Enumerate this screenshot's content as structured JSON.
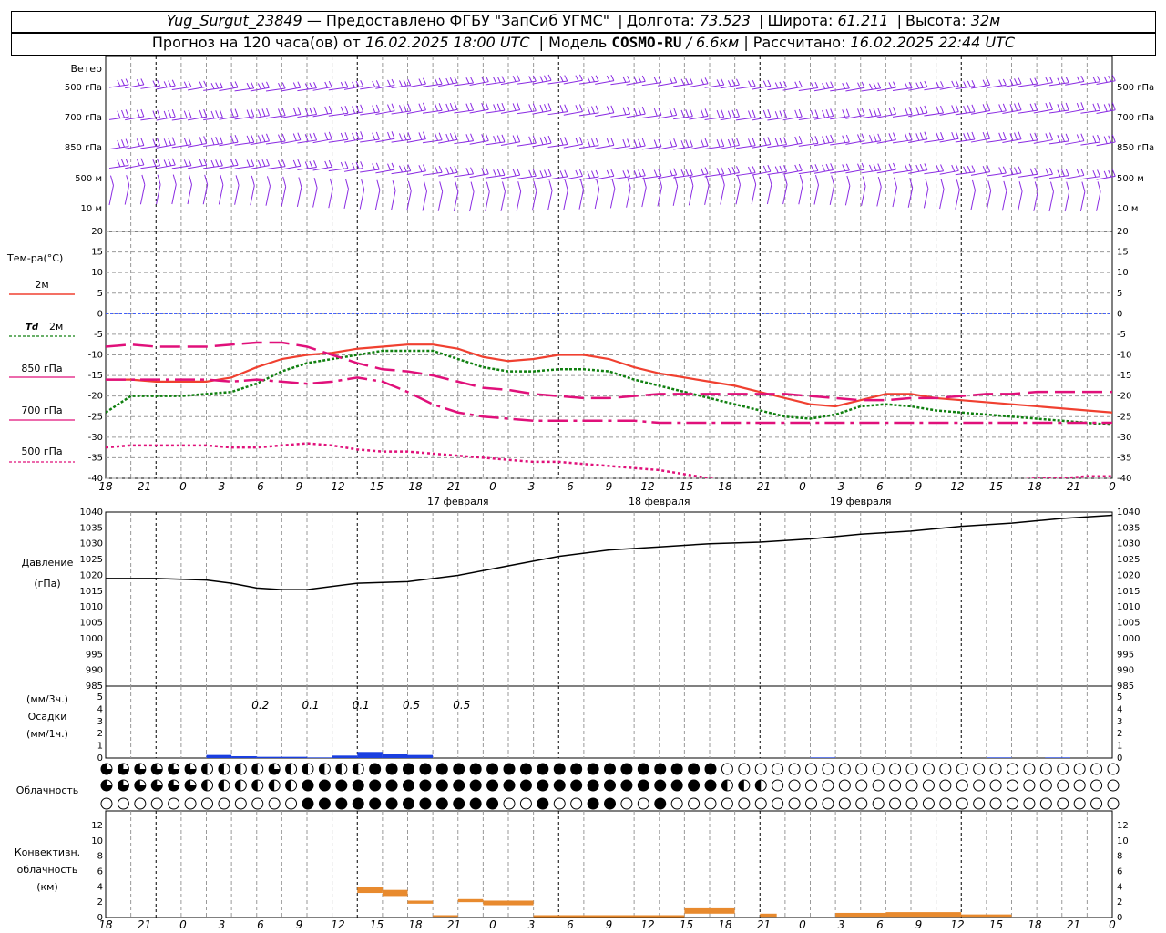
{
  "header": {
    "station": "Yug_Surgut_23849",
    "provider": "— Предоставлено ФГБУ \"ЗапСиб УГМС\"",
    "lon_label": "Долгота:",
    "lon": "73.523",
    "lat_label": "Широта:",
    "lat": "61.211",
    "alt_label": "Высота:",
    "alt": "32м",
    "forecast_label": "Прогноз на 120 часа(ов) от",
    "forecast_start": "16.02.2025 18:00 UTC",
    "model_label": "| Модель",
    "model": "COSMO-RU",
    "resolution": "/ 6.6км",
    "computed_label": "| Рассчитано:",
    "computed": "16.02.2025 22:44 UTC"
  },
  "colors": {
    "wind": "#8a2be2",
    "t2m": "#f04030",
    "td2m": "#108010",
    "t850": "#e0107a",
    "t700": "#e0107a",
    "t500": "#e0107a",
    "zero_line": "#3050ff",
    "pressure": "#000000",
    "precip": "#1a3fe0",
    "conv": "#e88a2e",
    "grid": "#9a9a9a"
  },
  "x_axis": {
    "ticks": [
      "18",
      "21",
      "0",
      "3",
      "6",
      "9",
      "12",
      "15",
      "18",
      "21",
      "0",
      "3",
      "6",
      "9",
      "12",
      "15",
      "18",
      "21",
      "0",
      "3",
      "6",
      "9",
      "12",
      "15",
      "18",
      "21",
      "0"
    ],
    "dates": [
      "17 февраля",
      "18 февраля",
      "19 февраля"
    ]
  },
  "wind_panel": {
    "title": "Ветер",
    "levels": [
      "500 гПа",
      "700 гПа",
      "850 гПа",
      "500 м",
      "10 м"
    ]
  },
  "temp_panel": {
    "title": "Тем-ра(°C)",
    "legend": [
      {
        "label": "2м",
        "prefix": ""
      },
      {
        "label": "2м",
        "prefix": "Td"
      },
      {
        "label": "850 гПа",
        "prefix": ""
      },
      {
        "label": "700 гПа",
        "prefix": ""
      },
      {
        "label": "500 гПа",
        "prefix": ""
      }
    ]
  },
  "pressure_panel": {
    "title": "Давление",
    "unit": "(гПа)"
  },
  "precip_panel": {
    "unit3": "(мм/3ч.)",
    "title": "Осадки",
    "unit1": "(мм/1ч.)",
    "totals": [
      "0.2",
      "0.1",
      "0.1",
      "0.5",
      "0.5"
    ]
  },
  "cloud_panel": {
    "title": "Облачность"
  },
  "conv_panel": {
    "title": "Конвективн.",
    "title2": "облачность",
    "unit": "(км)"
  },
  "chart_data": [
    {
      "type": "line",
      "title": "Тем-ра(°C)",
      "x_hours": [
        0,
        3,
        6,
        9,
        12,
        15,
        18,
        21,
        24,
        27,
        30,
        33,
        36,
        39,
        42,
        45,
        48,
        51,
        54,
        57,
        60,
        63,
        66,
        69,
        72,
        75,
        78,
        81,
        84,
        87,
        90,
        93,
        96,
        99,
        102,
        105,
        108,
        111,
        114,
        117,
        120
      ],
      "ylim": [
        -40,
        20
      ],
      "ticks": [
        20,
        15,
        10,
        5,
        0,
        -5,
        -10,
        -15,
        -20,
        -25,
        -30,
        -35,
        -40
      ],
      "series": [
        {
          "name": "2м",
          "values": [
            -16,
            -16,
            -16.5,
            -16.5,
            -16.5,
            -15.5,
            -13,
            -11,
            -10,
            -9.5,
            -8.5,
            -8,
            -7.5,
            -7.5,
            -8.5,
            -10.5,
            -11.5,
            -11,
            -10,
            -10,
            -11,
            -13,
            -14.5,
            -15.5,
            -16.5,
            -17.5,
            -19,
            -20.5,
            -22,
            -22.5,
            -21,
            -19.5,
            -19.5,
            -20.5,
            -21,
            -21.5,
            -22,
            -22.5,
            -23,
            -23.5,
            -24
          ]
        },
        {
          "name": "Td 2м",
          "values": [
            -24,
            -20,
            -20,
            -20,
            -19.5,
            -19,
            -17,
            -14,
            -12,
            -11,
            -10,
            -9,
            -9,
            -9,
            -11,
            -13,
            -14,
            -14,
            -13.5,
            -13.5,
            -14,
            -16,
            -17.5,
            -19,
            -20.5,
            -22,
            -23.5,
            -25,
            -25.5,
            -24.5,
            -22.5,
            -22,
            -22.5,
            -23.5,
            -24,
            -24.5,
            -25,
            -25.5,
            -26,
            -26.5,
            -27
          ]
        },
        {
          "name": "850 гПа",
          "values": [
            -8,
            -7.5,
            -8,
            -8,
            -8,
            -7.5,
            -7,
            -7,
            -8,
            -10,
            -12,
            -13.5,
            -14,
            -15,
            -16.5,
            -18,
            -18.5,
            -19.5,
            -20,
            -20.5,
            -20.5,
            -20,
            -19.5,
            -19.5,
            -19.5,
            -19.5,
            -19.5,
            -19.5,
            -20,
            -20.5,
            -21,
            -21,
            -20.5,
            -20.5,
            -20,
            -19.5,
            -19.5,
            -19,
            -19,
            -19,
            -19
          ]
        },
        {
          "name": "700 гПа",
          "values": [
            -16,
            -16,
            -16,
            -16,
            -16,
            -16.5,
            -16,
            -16.5,
            -17,
            -16.5,
            -15.5,
            -16.5,
            -19,
            -22,
            -24,
            -25,
            -25.5,
            -26,
            -26,
            -26,
            -26,
            -26,
            -26.5,
            -26.5,
            -26.5,
            -26.5,
            -26.5,
            -26.5,
            -26.5,
            -26.5,
            -26.5,
            -26.5,
            -26.5,
            -26.5,
            -26.5,
            -26.5,
            -26.5,
            -26.5,
            -26.5,
            -26.5,
            -26.5
          ]
        },
        {
          "name": "500 гПа",
          "values": [
            -32.5,
            -32,
            -32,
            -32,
            -32,
            -32.5,
            -32.5,
            -32,
            -31.5,
            -32,
            -33,
            -33.5,
            -33.5,
            -34,
            -34.5,
            -35,
            -35.5,
            -36,
            -36,
            -36.5,
            -37,
            -37.5,
            -38,
            -39,
            -40,
            -41,
            -41.5,
            -41.5,
            -41.5,
            -41.5,
            -41.5,
            -41.5,
            -41.5,
            -41.5,
            -41.5,
            -41,
            -40.5,
            -40,
            -40,
            -39.5,
            -39.5
          ]
        }
      ]
    },
    {
      "type": "line",
      "title": "Давление",
      "ylabel": "(гПа)",
      "x_hours": [
        0,
        6,
        12,
        15,
        18,
        21,
        24,
        30,
        36,
        42,
        48,
        54,
        60,
        66,
        72,
        78,
        84,
        90,
        96,
        102,
        108,
        114,
        120
      ],
      "ylim": [
        985,
        1040
      ],
      "ticks": [
        1040,
        1035,
        1030,
        1025,
        1020,
        1015,
        1010,
        1005,
        1000,
        995,
        990,
        985
      ],
      "series": [
        {
          "name": "Давление",
          "values": [
            1019,
            1019,
            1018.5,
            1017.5,
            1016,
            1015.5,
            1015.5,
            1017.5,
            1018,
            1020,
            1023,
            1026,
            1028,
            1029,
            1030,
            1030.5,
            1031.5,
            1033,
            1034,
            1035.5,
            1036.5,
            1038,
            1039
          ]
        }
      ]
    },
    {
      "type": "bar",
      "title": "Осадки",
      "x_hours": [
        6,
        9,
        12,
        15,
        18,
        21,
        24,
        27,
        30,
        33,
        36,
        39,
        84,
        105,
        112
      ],
      "ylim": [
        0,
        5
      ],
      "ticks": [
        5,
        4,
        3,
        2,
        1,
        0
      ],
      "values": [
        0,
        0,
        0.25,
        0.15,
        0.1,
        0.1,
        0.05,
        0.2,
        0.5,
        0.35,
        0.25,
        0,
        0.05,
        0.05,
        0.05
      ]
    },
    {
      "type": "bar",
      "title": "Конвективн. облачность",
      "ylabel": "(км)",
      "ylim": [
        0,
        14
      ],
      "ticks": [
        12,
        10,
        8,
        6,
        4,
        2,
        0
      ],
      "bars": [
        {
          "from": 30,
          "to": 33,
          "bottom": 3.2,
          "top": 4.0
        },
        {
          "from": 33,
          "to": 36,
          "bottom": 2.8,
          "top": 3.6
        },
        {
          "from": 36,
          "to": 39,
          "bottom": 1.8,
          "top": 2.2
        },
        {
          "from": 39,
          "to": 42,
          "bottom": 0.1,
          "top": 0.3
        },
        {
          "from": 42,
          "to": 45,
          "bottom": 2.0,
          "top": 2.4
        },
        {
          "from": 45,
          "to": 51,
          "bottom": 1.6,
          "top": 2.2
        },
        {
          "from": 51,
          "to": 69,
          "bottom": 0.05,
          "top": 0.3
        },
        {
          "from": 69,
          "to": 75,
          "bottom": 0.5,
          "top": 1.2
        },
        {
          "from": 78,
          "to": 80,
          "bottom": 0.1,
          "top": 0.5
        },
        {
          "from": 87,
          "to": 93,
          "bottom": 0.1,
          "top": 0.6
        },
        {
          "from": 93,
          "to": 102,
          "bottom": 0.1,
          "top": 0.7
        },
        {
          "from": 102,
          "to": 108,
          "bottom": 0.1,
          "top": 0.4
        }
      ]
    }
  ]
}
